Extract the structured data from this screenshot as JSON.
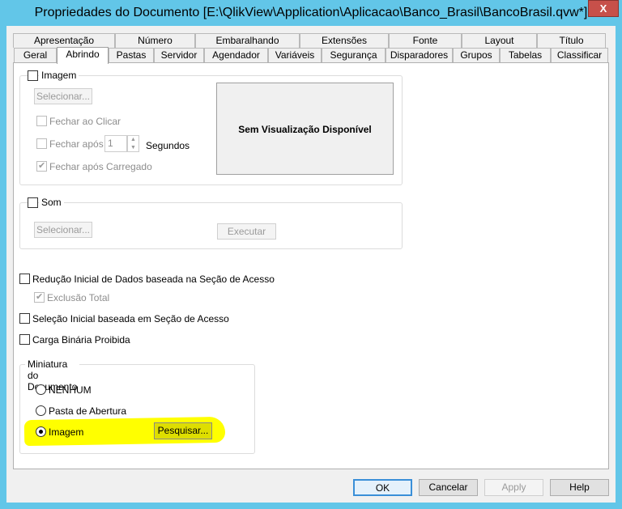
{
  "window": {
    "title": "Propriedades do Documento [E:\\QlikView\\Application\\Aplicacao\\Banco_Brasil\\BancoBrasil.qvw*]",
    "close_label": "X"
  },
  "tabs_row1": [
    "Apresentação",
    "Número",
    "Embaralhando",
    "Extensões",
    "Fonte",
    "Layout",
    "Título"
  ],
  "tabs_row2": [
    "Geral",
    "Abrindo",
    "Pastas",
    "Servidor",
    "Agendador",
    "Variáveis",
    "Segurança",
    "Disparadores",
    "Grupos",
    "Tabelas",
    "Classificar"
  ],
  "active_tab": "Abrindo",
  "image_group": {
    "label": "Imagem",
    "checked": false,
    "select_button": "Selecionar...",
    "close_on_click": "Fechar ao Clicar",
    "close_after": "Fechar após",
    "seconds_value": "1",
    "seconds_label": "Segundos",
    "close_after_loaded": "Fechar após Carregado",
    "close_after_loaded_checked": true,
    "preview_text": "Sem Visualização Disponível"
  },
  "sound_group": {
    "label": "Som",
    "checked": false,
    "select_button": "Selecionar...",
    "execute_button": "Executar"
  },
  "options": {
    "reduction": "Redução Inicial de Dados baseada na Seção de Acesso",
    "total_exclusion": "Exclusão Total",
    "total_exclusion_checked": true,
    "initial_selection": "Seleção Inicial baseada em Seção de Acesso",
    "binary_load": "Carga Binária Proibida"
  },
  "thumbnail": {
    "label": "Miniatura do Documento",
    "options": [
      "NENHUM",
      "Pasta de Abertura",
      "Imagem"
    ],
    "selected": "Imagem",
    "search_button": "Pesquisar..."
  },
  "highlight_color": "#ffff00",
  "footer": {
    "ok": "OK",
    "cancel": "Cancelar",
    "apply": "Apply",
    "help": "Help"
  }
}
